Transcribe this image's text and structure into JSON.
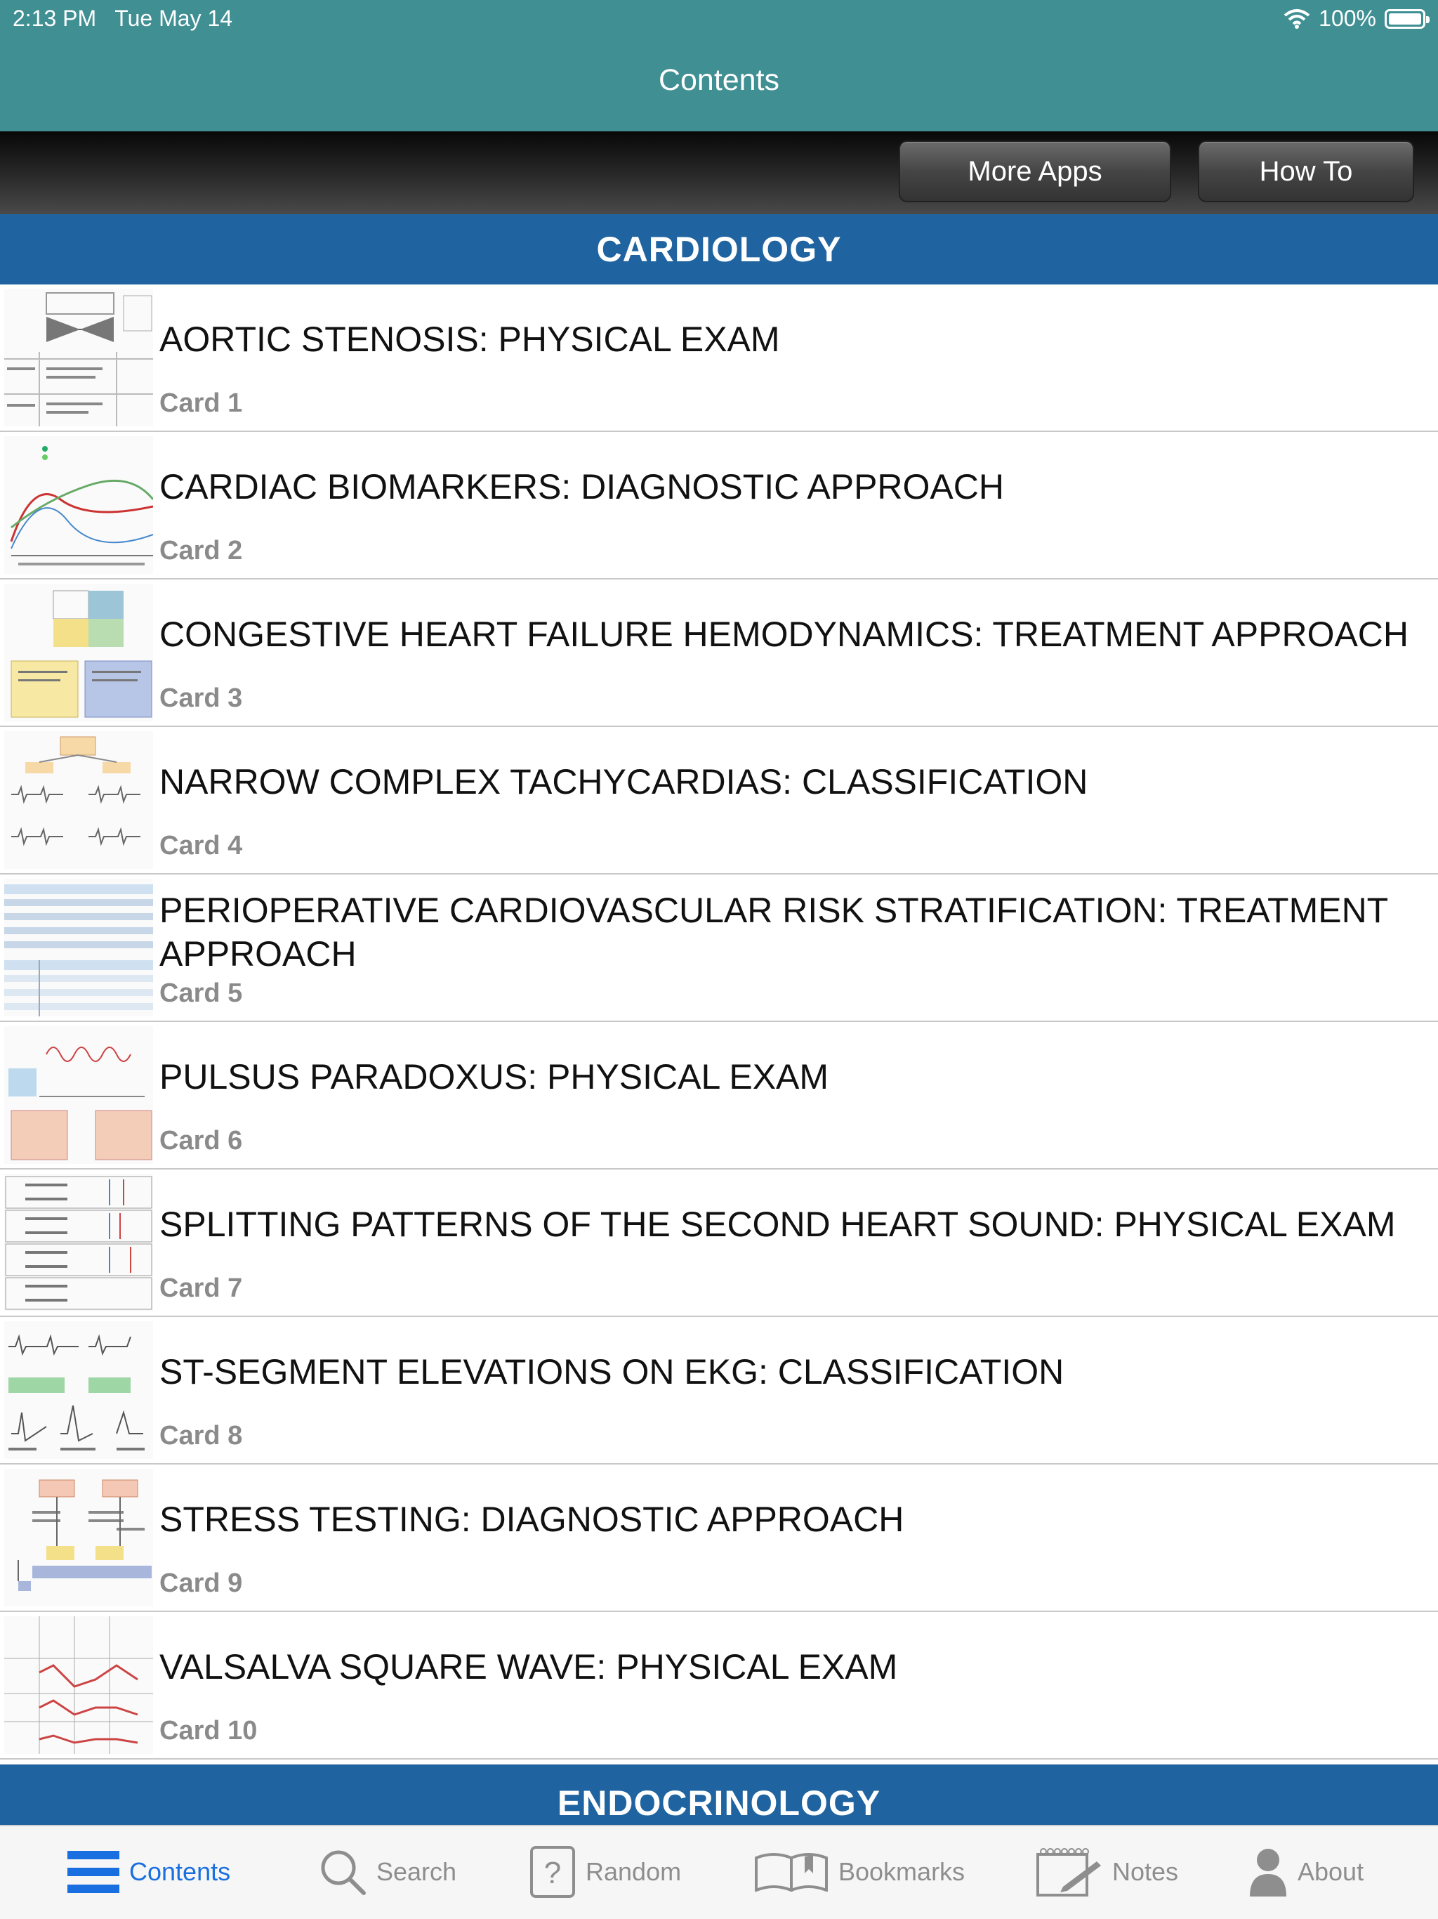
{
  "status": {
    "time": "2:13 PM",
    "date": "Tue May 14",
    "battery": "100%"
  },
  "nav": {
    "title": "Contents"
  },
  "toolbar": {
    "more_apps": "More Apps",
    "how_to": "How To"
  },
  "sections": [
    {
      "name": "CARDIOLOGY",
      "items": [
        {
          "title": "AORTIC STENOSIS: PHYSICAL EXAM",
          "sub": "Card 1",
          "thumb": "thumb-icon"
        },
        {
          "title": "CARDIAC BIOMARKERS: DIAGNOSTIC APPROACH",
          "sub": "Card 2",
          "thumb": "thumb-icon"
        },
        {
          "title": "CONGESTIVE HEART FAILURE HEMODYNAMICS: TREATMENT APPROACH",
          "sub": "Card 3",
          "thumb": "thumb-icon"
        },
        {
          "title": "NARROW COMPLEX TACHYCARDIAS: CLASSIFICATION",
          "sub": "Card 4",
          "thumb": "thumb-icon"
        },
        {
          "title": "PERIOPERATIVE CARDIOVASCULAR RISK STRATIFICATION: TREATMENT APPROACH",
          "sub": "Card 5",
          "thumb": "thumb-icon"
        },
        {
          "title": "PULSUS PARADOXUS: PHYSICAL EXAM",
          "sub": "Card 6",
          "thumb": "thumb-icon"
        },
        {
          "title": "SPLITTING PATTERNS OF THE SECOND HEART SOUND: PHYSICAL EXAM",
          "sub": "Card 7",
          "thumb": "thumb-icon"
        },
        {
          "title": "ST-SEGMENT ELEVATIONS ON EKG: CLASSIFICATION",
          "sub": "Card 8",
          "thumb": "thumb-icon"
        },
        {
          "title": "STRESS TESTING: DIAGNOSTIC APPROACH",
          "sub": "Card 9",
          "thumb": "thumb-icon"
        },
        {
          "title": "VALSALVA SQUARE WAVE: PHYSICAL EXAM",
          "sub": "Card 10",
          "thumb": "thumb-icon"
        }
      ]
    },
    {
      "name": "ENDOCRINOLOGY",
      "items": []
    }
  ],
  "tabs": [
    {
      "label": "Contents",
      "icon": "list-icon",
      "active": true
    },
    {
      "label": "Search",
      "icon": "search-icon"
    },
    {
      "label": "Random",
      "icon": "question-card-icon"
    },
    {
      "label": "Bookmarks",
      "icon": "book-icon"
    },
    {
      "label": "Notes",
      "icon": "notepad-icon"
    },
    {
      "label": "About",
      "icon": "person-icon"
    }
  ],
  "colors": {
    "nav": "#3f8f93",
    "section": "#1f64a0",
    "tab_active": "#1a6fe0",
    "tab_inactive": "#8e8e8e"
  }
}
